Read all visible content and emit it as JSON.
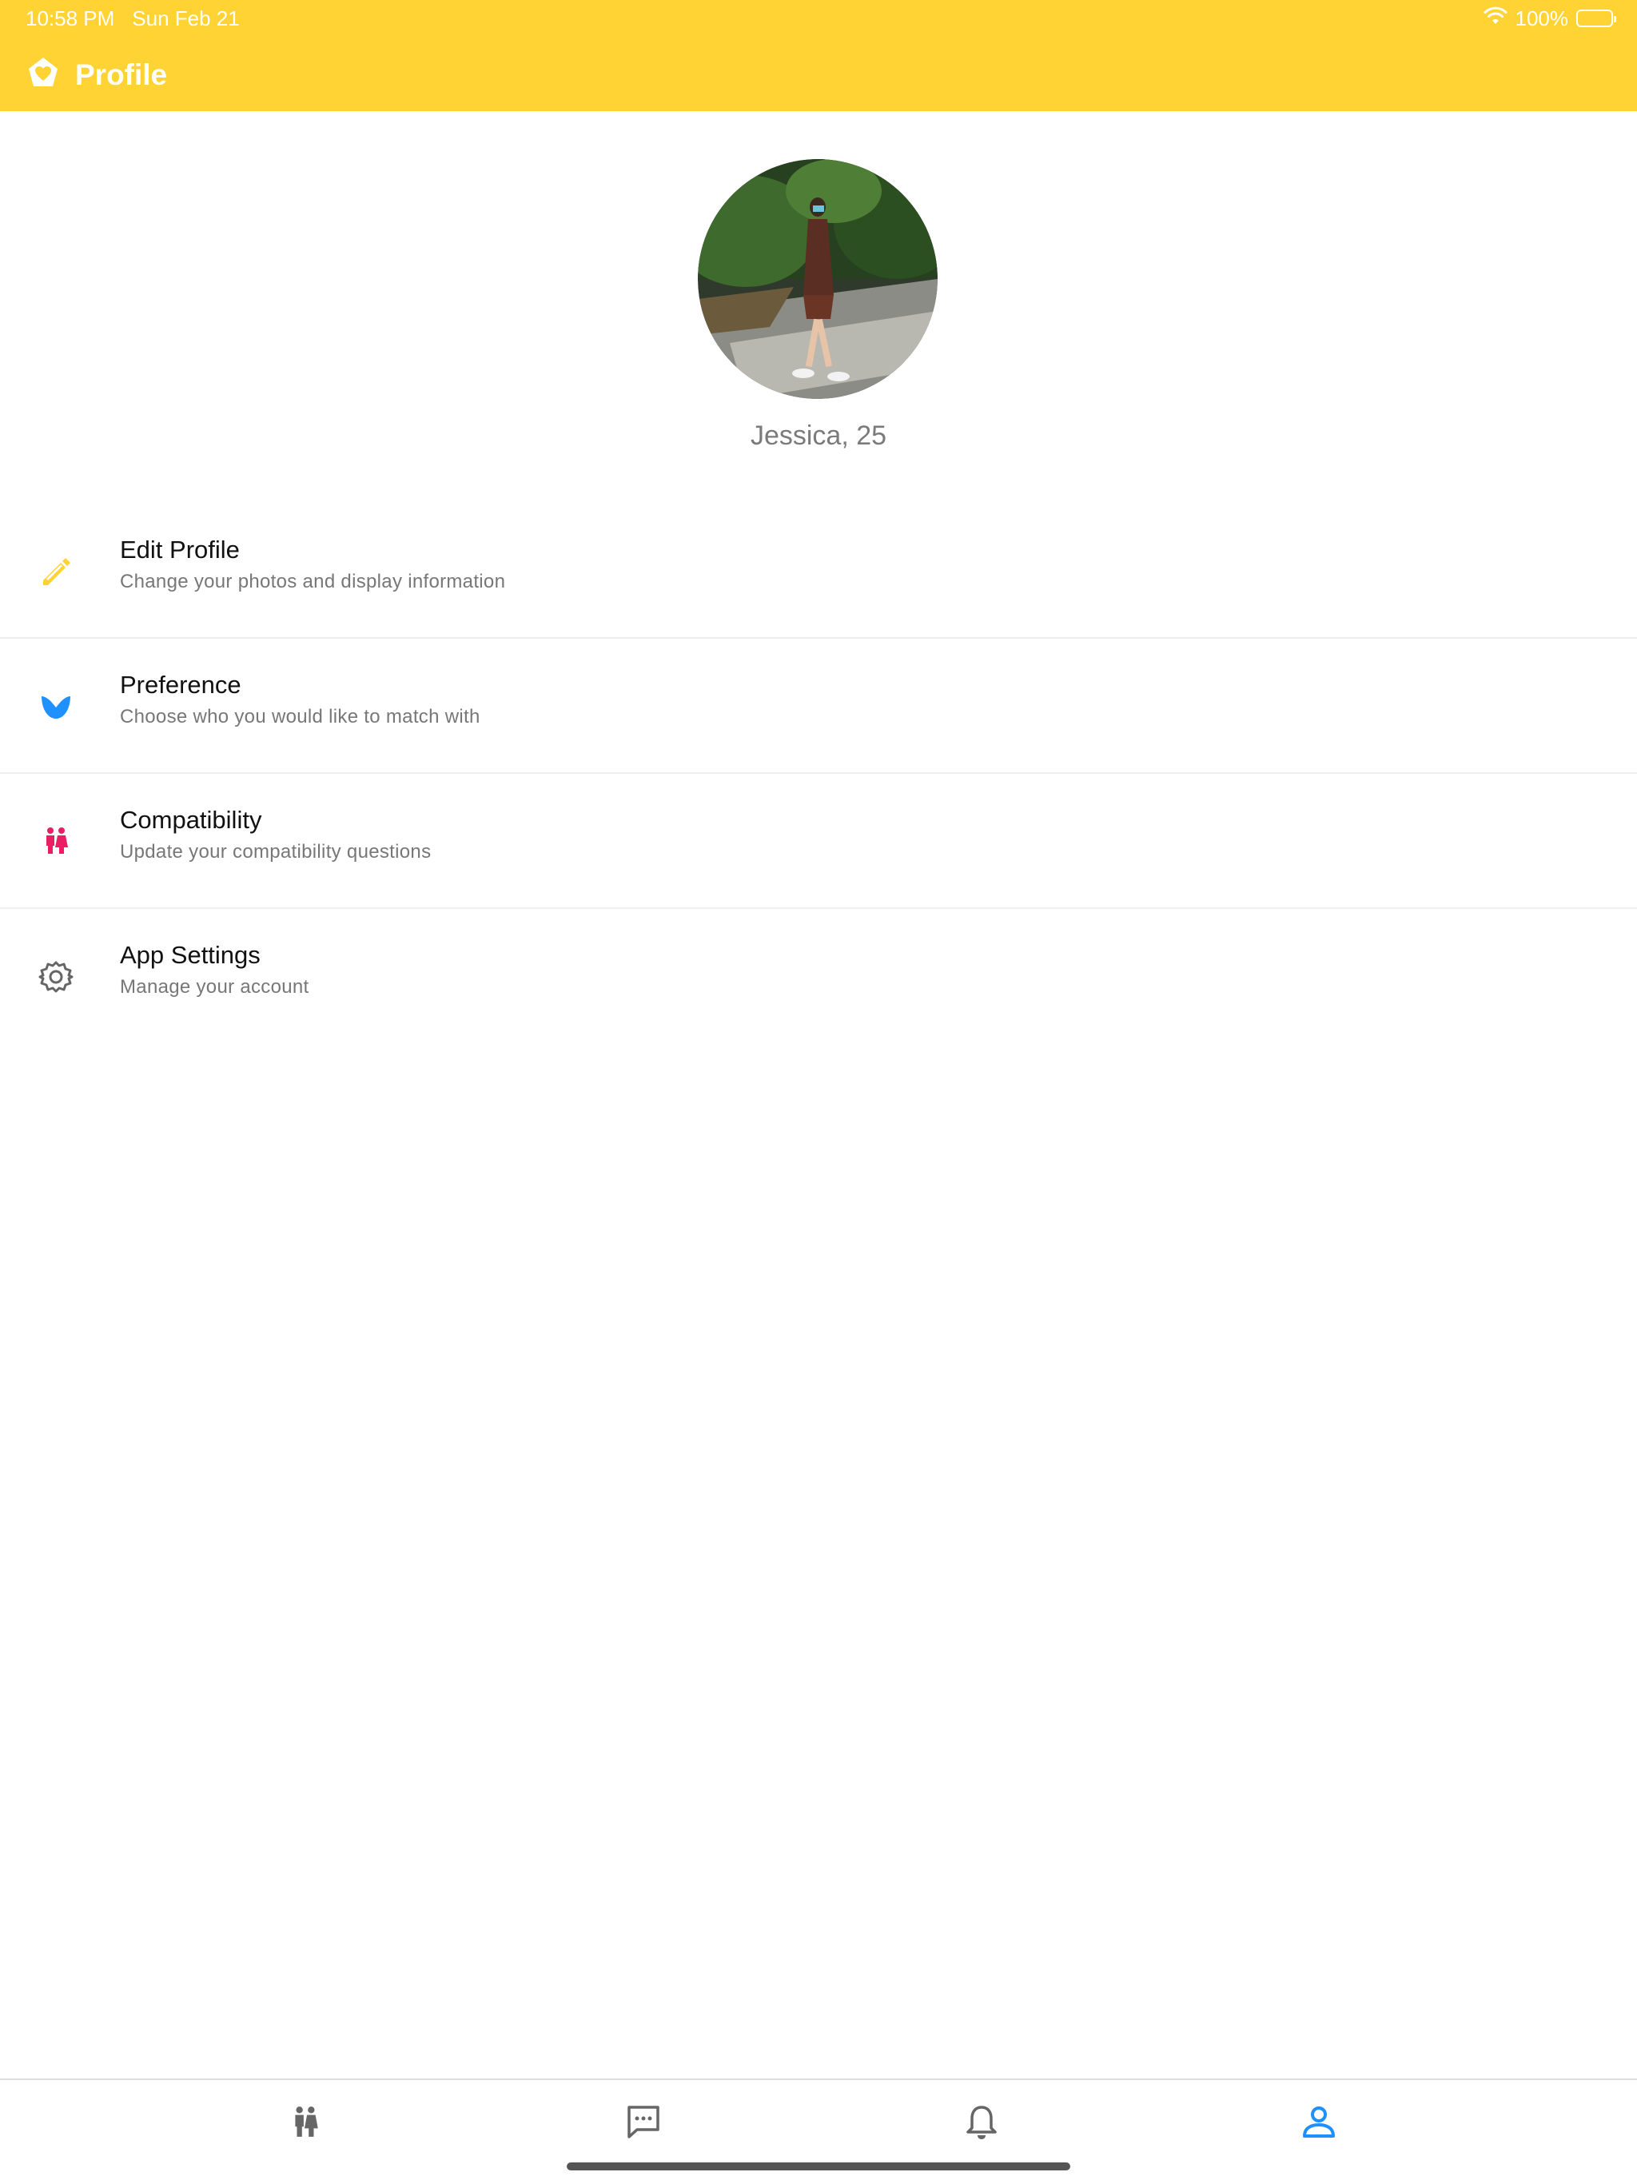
{
  "status_bar": {
    "time": "10:58 PM",
    "date": "Sun Feb 21",
    "battery": "100%",
    "battery_level": 1.0,
    "wifi_icon": "wifi-icon",
    "battery_icon": "battery-icon"
  },
  "header": {
    "title": "Profile",
    "logo_icon": "heart-hands-logo",
    "background_color": "#FFD333"
  },
  "profile": {
    "name_age": "Jessica, 25",
    "avatar": "profile-photo"
  },
  "menu": [
    {
      "title": "Edit Profile",
      "subtitle": "Change your photos and display information",
      "icon": "pencil-icon",
      "icon_color": "#FFD333"
    },
    {
      "title": "Preference",
      "subtitle": "Choose who you would like to match with",
      "icon": "preference-icon",
      "icon_color": "#1E90FF"
    },
    {
      "title": "Compatibility",
      "subtitle": "Update your compatibility questions",
      "icon": "couple-icon",
      "icon_color": "#E91E63"
    },
    {
      "title": "App Settings",
      "subtitle": "Manage your account",
      "icon": "gear-icon",
      "icon_color": "#666666"
    }
  ],
  "bottom_nav": {
    "items": [
      {
        "icon": "people-icon",
        "active": false
      },
      {
        "icon": "chat-icon",
        "active": false
      },
      {
        "icon": "bell-icon",
        "active": false
      },
      {
        "icon": "profile-icon",
        "active": true
      }
    ],
    "active_color": "#1E90FF",
    "inactive_color": "#666666"
  }
}
